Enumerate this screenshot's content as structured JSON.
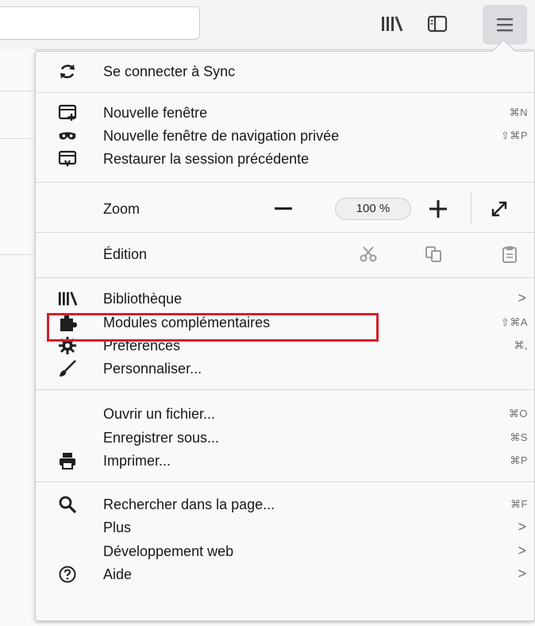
{
  "menu": {
    "sync": {
      "label": "Se connecter à Sync"
    },
    "new_window": {
      "label": "Nouvelle fenêtre",
      "shortcut": "⌘N"
    },
    "private_window": {
      "label": "Nouvelle fenêtre de navigation privée",
      "shortcut": "⇧⌘P"
    },
    "restore_session": {
      "label": "Restaurer la session précédente"
    },
    "zoom": {
      "label": "Zoom",
      "value": "100 %"
    },
    "edit": {
      "label": "Édition"
    },
    "library": {
      "label": "Bibliothèque",
      "chevron": ">"
    },
    "addons": {
      "label": "Modules complémentaires",
      "shortcut": "⇧⌘A"
    },
    "preferences": {
      "label": "Préférences",
      "shortcut": "⌘,"
    },
    "customize": {
      "label": "Personnaliser..."
    },
    "open_file": {
      "label": "Ouvrir un fichier...",
      "shortcut": "⌘O"
    },
    "save_as": {
      "label": "Enregistrer sous...",
      "shortcut": "⌘S"
    },
    "print": {
      "label": "Imprimer...",
      "shortcut": "⌘P"
    },
    "find": {
      "label": "Rechercher dans la page...",
      "shortcut": "⌘F"
    },
    "more": {
      "label": "Plus",
      "chevron": ">"
    },
    "webdev": {
      "label": "Développement web",
      "chevron": ">"
    },
    "help": {
      "label": "Aide",
      "chevron": ">"
    }
  },
  "icons": {
    "toolbar": [
      "library-icon",
      "sidebar-icon",
      "hamburger-menu-icon"
    ],
    "menu": [
      "sync-icon",
      "new-window-icon",
      "private-mask-icon",
      "restore-session-icon",
      "zoom-minus-icon",
      "zoom-plus-icon",
      "fullscreen-icon",
      "cut-icon",
      "copy-icon",
      "paste-icon",
      "library-icon",
      "puzzle-icon",
      "gear-icon",
      "brush-icon",
      "printer-icon",
      "search-icon",
      "help-icon"
    ]
  },
  "colors": {
    "highlight_border": "#d4202a",
    "panel_background": "#f9f9fa",
    "menu_button_active": "#dcdce0"
  }
}
